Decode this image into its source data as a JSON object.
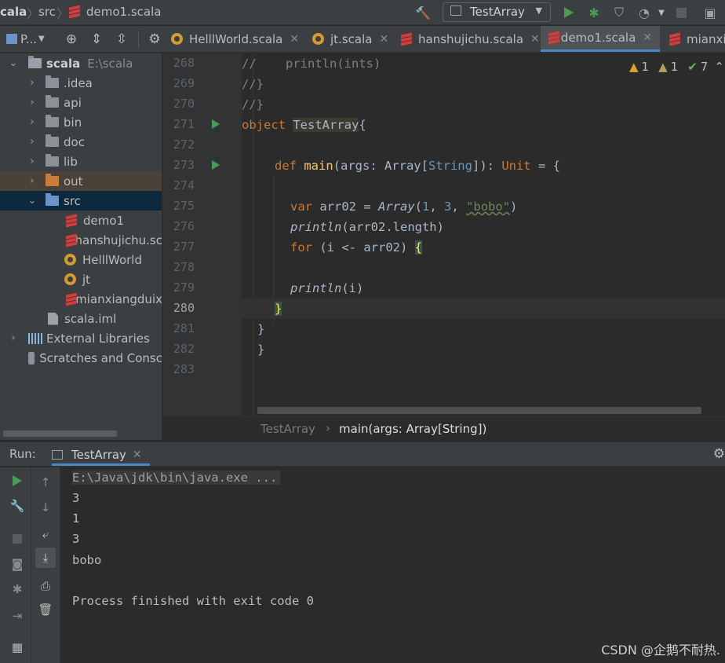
{
  "navbar": {
    "crumbs": [
      "cala",
      "src",
      "demo1.scala"
    ],
    "run_config": "TestArray"
  },
  "tabs": {
    "project_label": "P...",
    "files": [
      {
        "label": "HelllWorld.scala",
        "icon": "object-icon",
        "active": false
      },
      {
        "label": "jt.scala",
        "icon": "object-icon",
        "active": false
      },
      {
        "label": "hanshujichu.scala",
        "icon": "scala-icon",
        "active": false
      },
      {
        "label": "demo1.scala",
        "icon": "scala-file-icon",
        "active": true
      },
      {
        "label": "mianxi",
        "icon": "scala-icon",
        "active": false
      }
    ]
  },
  "project": {
    "root_name": "scala",
    "root_path": "E:\\scala",
    "items": [
      {
        "label": ".idea",
        "kind": "folder"
      },
      {
        "label": "api",
        "kind": "folder"
      },
      {
        "label": "bin",
        "kind": "folder"
      },
      {
        "label": "doc",
        "kind": "folder"
      },
      {
        "label": "lib",
        "kind": "folder"
      },
      {
        "label": "out",
        "kind": "folder-orange"
      },
      {
        "label": "src",
        "kind": "folder-blue"
      },
      {
        "label": "demo1",
        "kind": "scala-file"
      },
      {
        "label": "hanshujichu.sc",
        "kind": "scala"
      },
      {
        "label": "HelllWorld",
        "kind": "object"
      },
      {
        "label": "jt",
        "kind": "object"
      },
      {
        "label": "mianxiangduix",
        "kind": "scala"
      },
      {
        "label": "scala.iml",
        "kind": "file"
      },
      {
        "label": "External Libraries",
        "kind": "libraries"
      },
      {
        "label": "Scratches and Consc",
        "kind": "scratches"
      }
    ]
  },
  "editor": {
    "line_numbers": [
      "268",
      "269",
      "270",
      "271",
      "272",
      "273",
      "274",
      "275",
      "276",
      "277",
      "278",
      "279",
      "280",
      "281",
      "282",
      "283"
    ],
    "current_line": "280",
    "inspections": {
      "errors": "1",
      "warnings": "1",
      "ok": "7"
    },
    "breadcrumb": [
      "TestArray",
      "main(args: Array[String])"
    ],
    "code": {
      "l268": "//    println(ints)",
      "l269": "//}",
      "l270": "//}",
      "l271_kw": "object ",
      "l271_name": "TestArray",
      "l271_end": "{",
      "l273_kw": "def ",
      "l273_fn": "main",
      "l273_a": "(args: Array[",
      "l273_type": "String",
      "l273_b": "]): ",
      "l273_unit": "Unit",
      "l273_c": " = {",
      "l275_kw": "var ",
      "l275_a": "arr02 = ",
      "l275_arr": "Array",
      "l275_b": "(",
      "l275_n1": "1",
      "l275_c": ", ",
      "l275_n2": "3",
      "l275_d": ", ",
      "l275_str": "\"bobo\"",
      "l275_e": ")",
      "l276_fn": "println",
      "l276_a": "(arr02.length)",
      "l277_kw": "for ",
      "l277_a": "(i <- arr02) ",
      "l277_brace": "{",
      "l279_fn": "println",
      "l279_a": "(i)",
      "l280": "}",
      "l281": "}",
      "l282": "}"
    }
  },
  "run": {
    "label": "Run:",
    "tab": "TestArray",
    "command": "E:\\Java\\jdk\\bin\\java.exe ...",
    "output": [
      "3",
      "1",
      "3",
      "bobo"
    ],
    "finished": "Process finished with exit code 0"
  },
  "watermark": "CSDN @企鹅不耐热.",
  "colors": {
    "keyword": "#cc7832",
    "function": "#ffc66d",
    "number": "#6897bb",
    "string": "#6a8759",
    "comment": "#808080",
    "run_green": "#499c54",
    "selection": "#0d293e",
    "active_tab_underline": "#4a88c7"
  }
}
